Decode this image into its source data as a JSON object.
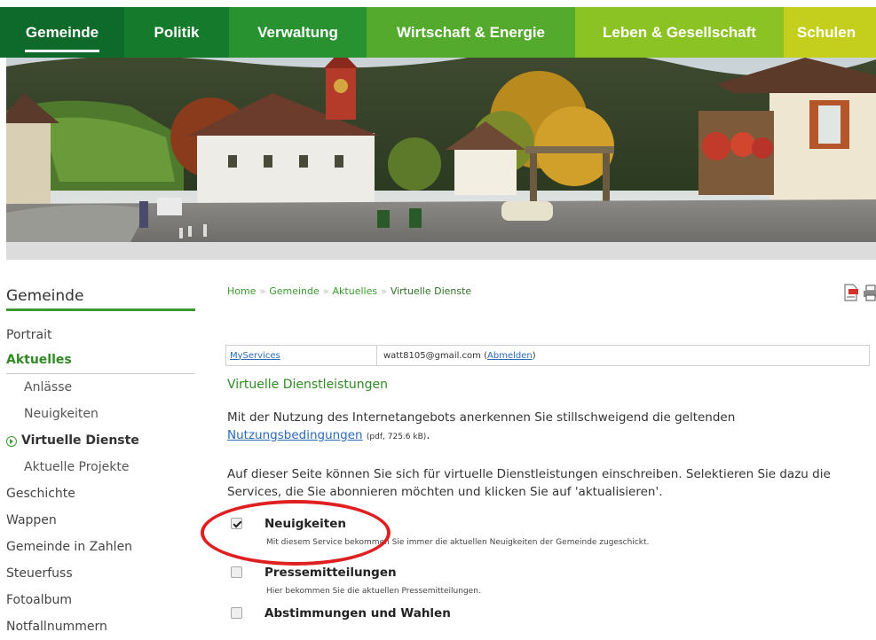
{
  "nav": {
    "items": [
      {
        "label": "Gemeinde",
        "color": "#0e6a2a",
        "active": true
      },
      {
        "label": "Politik",
        "color": "#157a2c"
      },
      {
        "label": "Verwaltung",
        "color": "#27922f"
      },
      {
        "label": "Wirtschaft & Energie",
        "color": "#54aa2d"
      },
      {
        "label": "Leben & Gesellschaft",
        "color": "#8cc324"
      },
      {
        "label": "Schulen",
        "color": "#c3cf1c"
      }
    ]
  },
  "sidebar": {
    "title": "Gemeinde",
    "items": [
      {
        "label": "Portrait"
      },
      {
        "label": "Aktuelles"
      },
      {
        "label": "Anlässe"
      },
      {
        "label": "Neuigkeiten"
      },
      {
        "label": "Virtuelle Dienste"
      },
      {
        "label": "Aktuelle Projekte"
      },
      {
        "label": "Geschichte"
      },
      {
        "label": "Wappen"
      },
      {
        "label": "Gemeinde in Zahlen"
      },
      {
        "label": "Steuerfuss"
      },
      {
        "label": "Fotoalbum"
      },
      {
        "label": "Notfallnummern"
      }
    ]
  },
  "breadcrumb": {
    "items": [
      "Home",
      "Gemeinde",
      "Aktuelles",
      "Virtuelle Dienste"
    ]
  },
  "services_box": {
    "label": "MyServices",
    "email": "watt8105@gmail.com",
    "logout_open": "(",
    "logout": "Abmelden",
    "logout_close": ")"
  },
  "content": {
    "section_title": "Virtuelle Dienstleistungen",
    "para1": "Mit der Nutzung des Internetangebots anerkennen Sie stillschweigend die geltenden",
    "terms_link": "Nutzungsbedingungen",
    "terms_meta": "(pdf, 725.6 kB)",
    "terms_end": ".",
    "para2": "Auf dieser Seite können Sie sich für virtuelle Dienstleistungen einschreiben. Selektieren Sie dazu die Services, die Sie abonnieren möchten und klicken Sie auf 'aktualisieren'."
  },
  "services": [
    {
      "title": "Neuigkeiten",
      "desc": "Mit diesem Service bekommen Sie immer die aktuellen Neuigkeiten der Gemeinde zugeschickt.",
      "checked": true
    },
    {
      "title": "Pressemitteilungen",
      "desc": "Hier bekommen Sie die aktuellen Pressemitteilungen.",
      "checked": false
    },
    {
      "title": "Abstimmungen und Wahlen",
      "desc": "",
      "checked": false
    }
  ],
  "colors": {
    "accent": "#3a9b2f",
    "highlight": "#e02020"
  }
}
